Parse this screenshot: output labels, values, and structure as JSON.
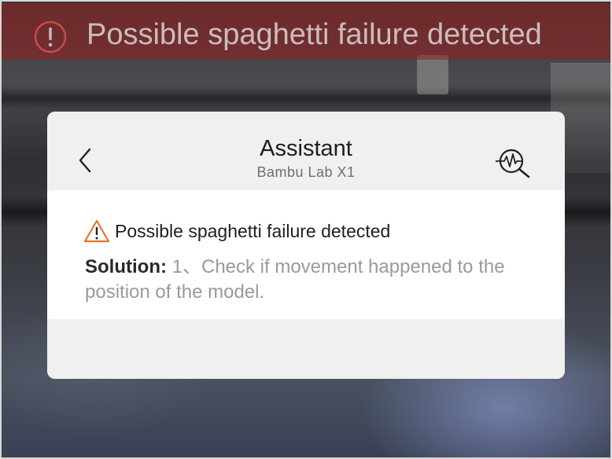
{
  "banner": {
    "text": "Possible spaghetti failure detected",
    "icon": "exclamation-circle-icon",
    "color": "#961e1e"
  },
  "dialog": {
    "title": "Assistant",
    "subtitle": "Bambu Lab X1",
    "back_icon": "chevron-left-icon",
    "diagnose_icon": "magnifier-pulse-icon",
    "alert": {
      "icon": "warning-triangle-icon",
      "icon_color": "#e8742a",
      "title": "Possible spaghetti failure detected"
    },
    "solution": {
      "label": "Solution:",
      "text": " 1、Check if movement happened to the position of the model."
    }
  }
}
